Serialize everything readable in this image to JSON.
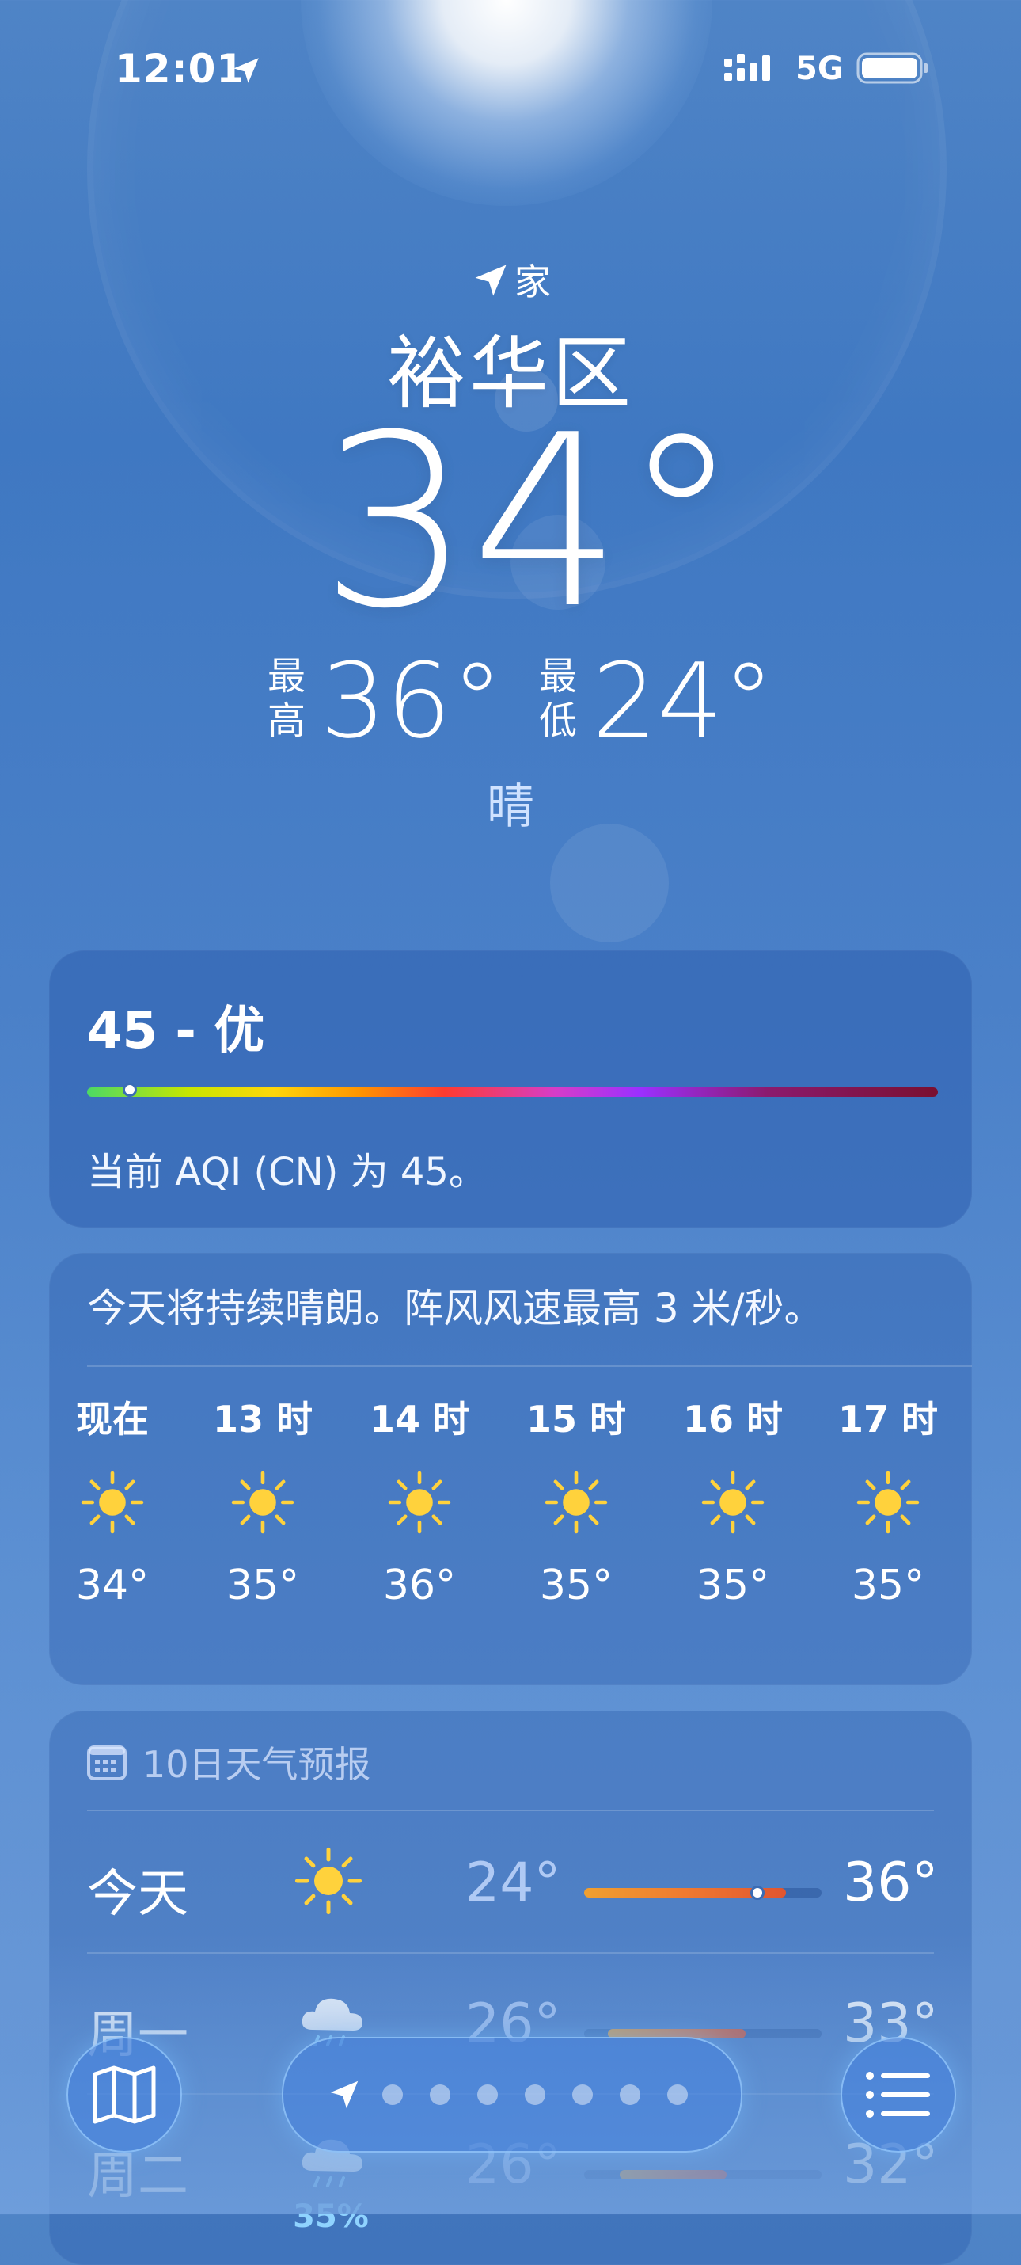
{
  "status_bar": {
    "time": "12:01",
    "network": "5G"
  },
  "location": {
    "label": "家",
    "city": "裕华区"
  },
  "current": {
    "temperature": "34°",
    "high_label": "最高",
    "high": "36°",
    "low_label": "最低",
    "low": "24°",
    "condition": "晴"
  },
  "aqi": {
    "value": "45 - 优",
    "description": "当前 AQI (CN) 为 45。",
    "level": 0.05
  },
  "hourly": {
    "summary": "今天将持续晴朗。阵风风速最高 3 米/秒。",
    "items": [
      {
        "label": "现在",
        "icon": "sun-icon",
        "temp": "34°"
      },
      {
        "label": "13 时",
        "icon": "sun-icon",
        "temp": "35°"
      },
      {
        "label": "14 时",
        "icon": "sun-icon",
        "temp": "36°"
      },
      {
        "label": "15 时",
        "icon": "sun-icon",
        "temp": "35°"
      },
      {
        "label": "16 时",
        "icon": "sun-icon",
        "temp": "35°"
      },
      {
        "label": "17 时",
        "icon": "sun-icon",
        "temp": "35°"
      }
    ]
  },
  "daily": {
    "title": "10日天气预报",
    "days": [
      {
        "name": "今天",
        "icon": "sun-icon",
        "precip": "",
        "low": "24°",
        "high": "36°"
      },
      {
        "name": "周一",
        "icon": "cloud-rain-icon",
        "precip": "",
        "low": "26°",
        "high": "33°"
      },
      {
        "name": "周二",
        "icon": "cloud-rain-icon",
        "precip": "35%",
        "low": "26°",
        "high": "32°"
      }
    ]
  },
  "colors": {
    "accent": "#3f78c2",
    "precip": "#8fd3ff",
    "sun": "#ffd23c"
  }
}
